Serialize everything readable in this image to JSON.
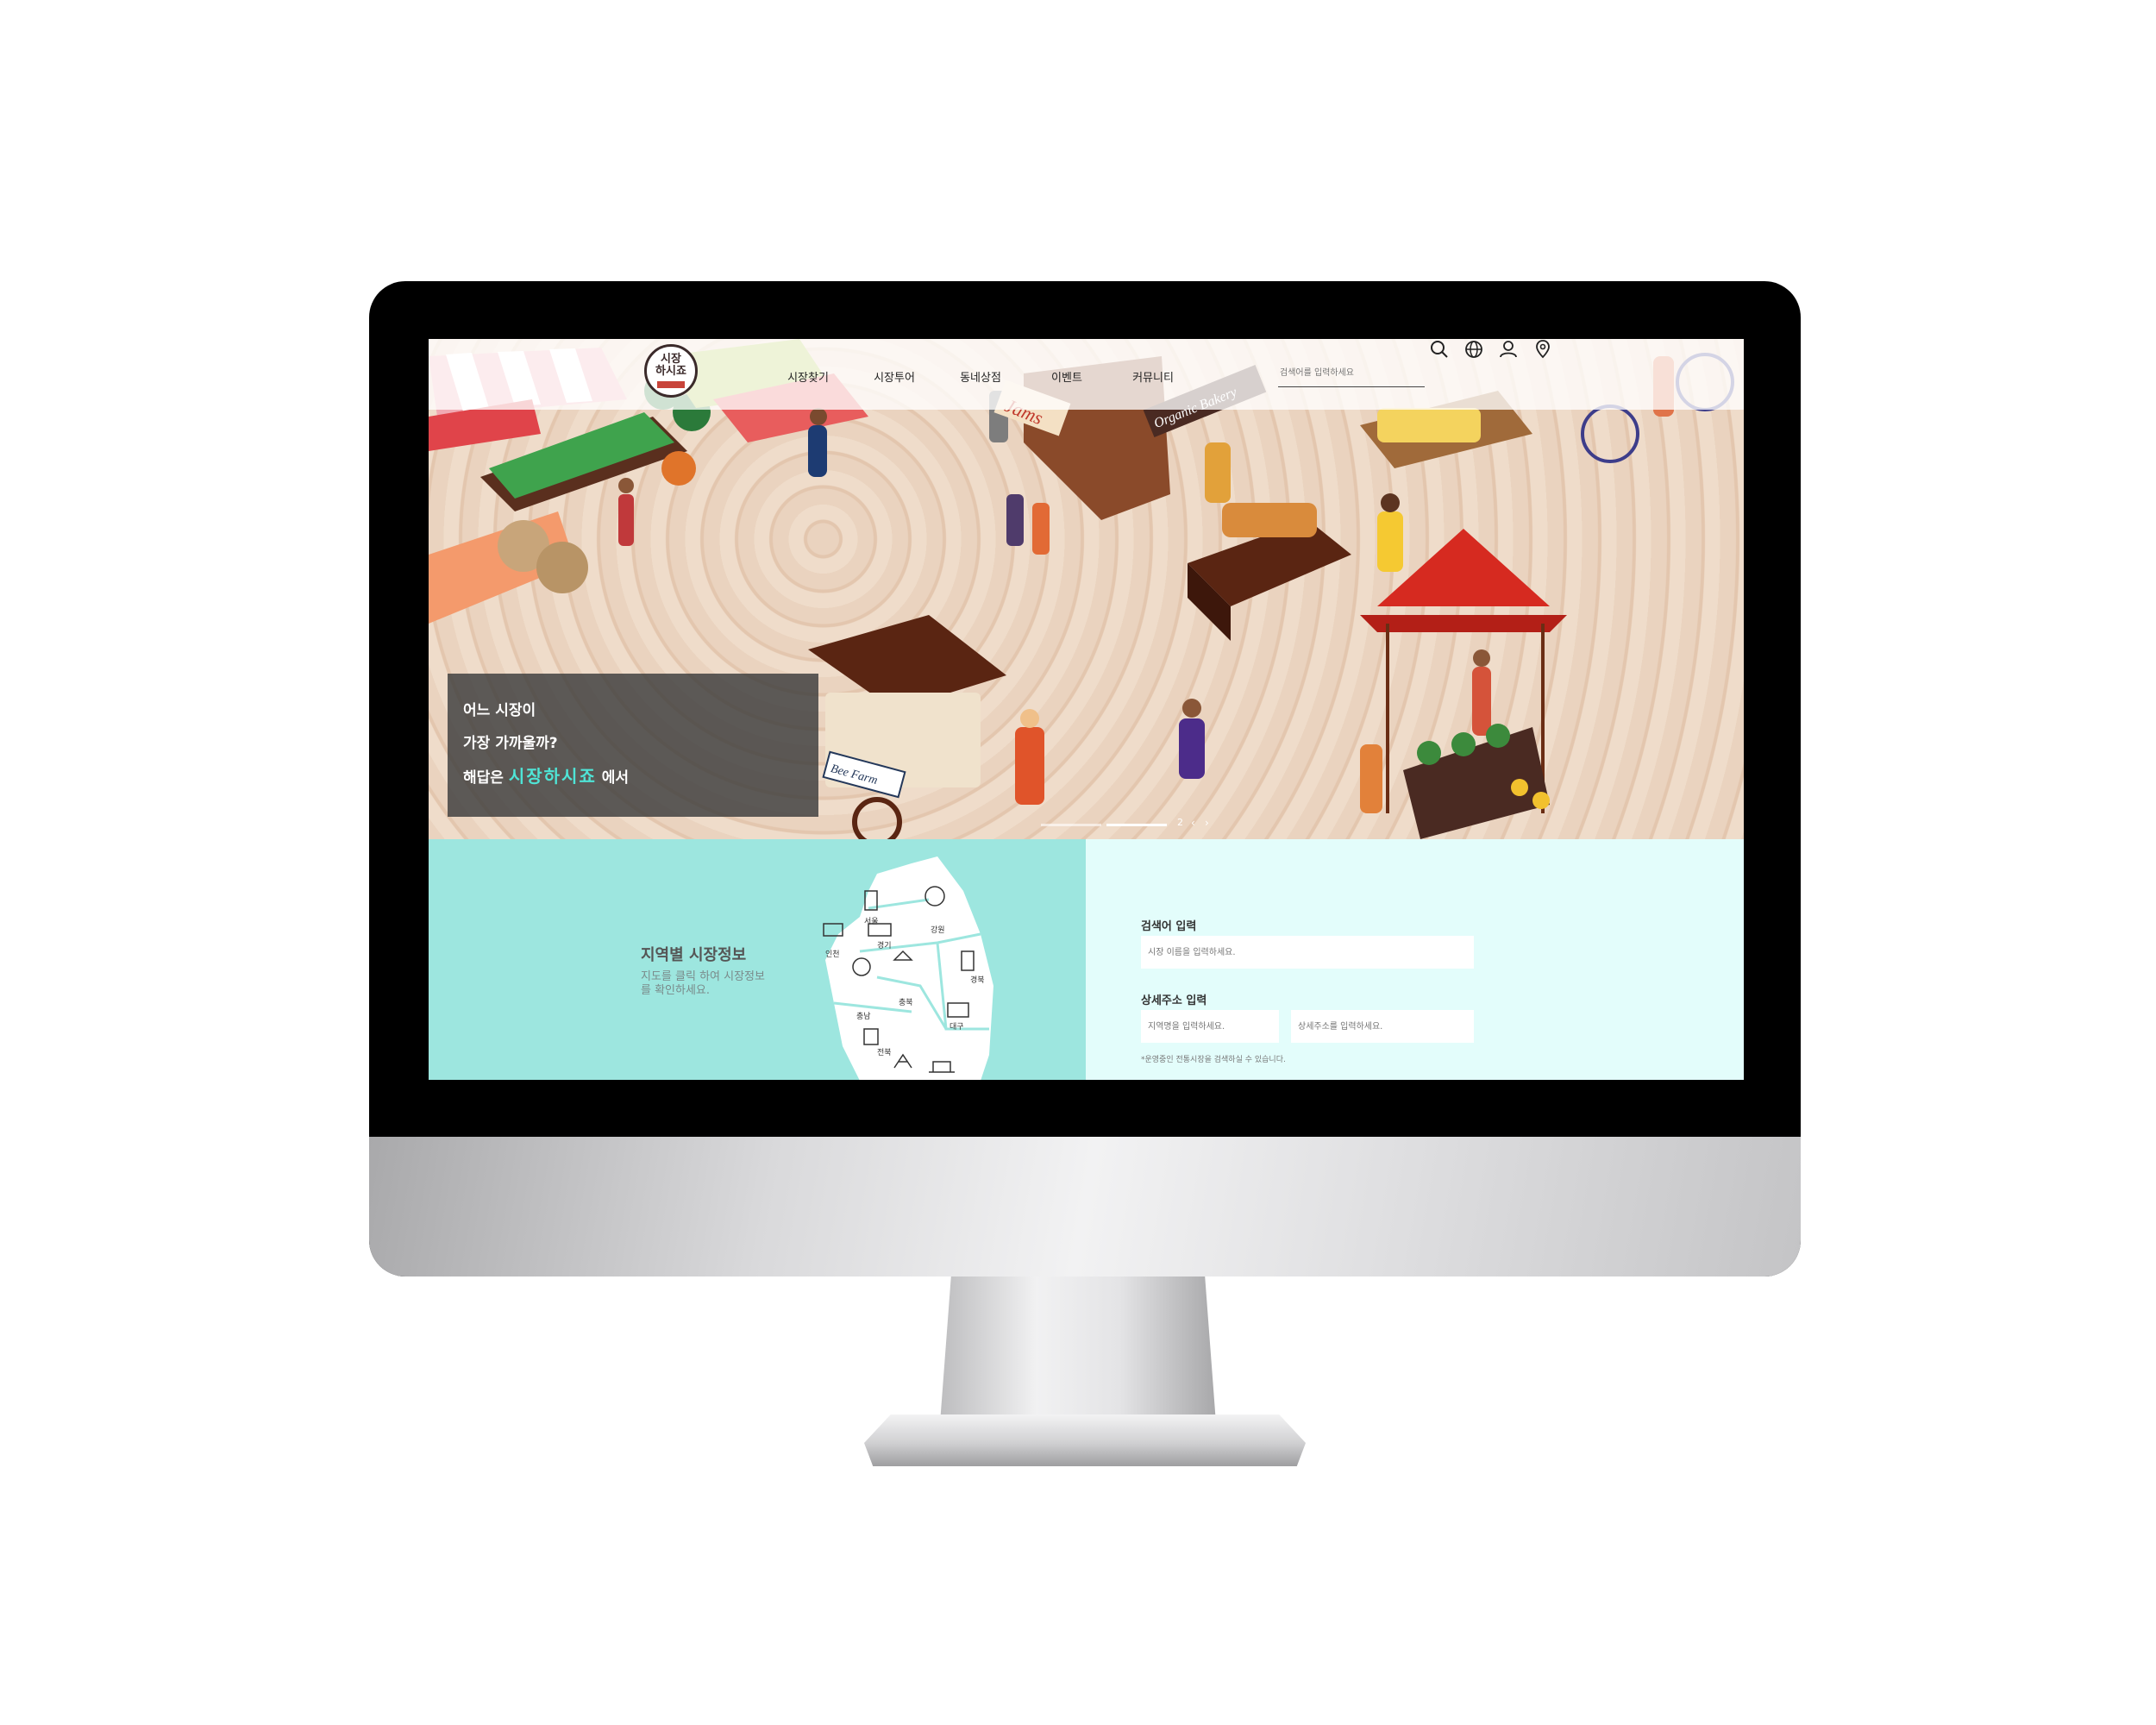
{
  "logo": {
    "line1": "시장",
    "line2": "하시죠"
  },
  "nav": {
    "items": [
      "시장찾기",
      "시장투어",
      "동네상점",
      "이벤트",
      "커뮤니티"
    ],
    "search_placeholder": "검색어를 입력하세요",
    "icons": [
      "search-icon",
      "globe-icon",
      "user-icon",
      "location-pin-icon"
    ]
  },
  "hero": {
    "caption_line1": "어느 시장이",
    "caption_line2": "가장 가까울까?",
    "caption_line3_prefix": "해답은",
    "caption_line3_accent": "시장하시죠",
    "caption_line3_suffix": "에서",
    "slide_counter": "2",
    "prev_arrow": "‹",
    "next_arrow": "›",
    "sign_jams": "Jams",
    "sign_bakery": "Organic Bakery",
    "sign_farm": "Bee Farm"
  },
  "map_section": {
    "title": "지역별 시장정보",
    "desc": "지도를 클릭 하여 시장정보를 확인하세요.",
    "regions": [
      "서울",
      "강원",
      "인천",
      "경기",
      "충북",
      "충남",
      "경북",
      "대구",
      "전북"
    ]
  },
  "search_section": {
    "keyword_label": "검색어 입력",
    "keyword_placeholder": "시장 이름을 입력하세요.",
    "address_label": "상세주소 입력",
    "region_placeholder": "지역명을 입력하세요.",
    "detail_placeholder": "상세주소를 입력하세요.",
    "note": "*운영중인 전통시장을 검색하실 수 있습니다."
  },
  "colors": {
    "accent": "#4fe4d6",
    "map_bg": "#9de6df",
    "search_bg": "#e3fdfb"
  }
}
